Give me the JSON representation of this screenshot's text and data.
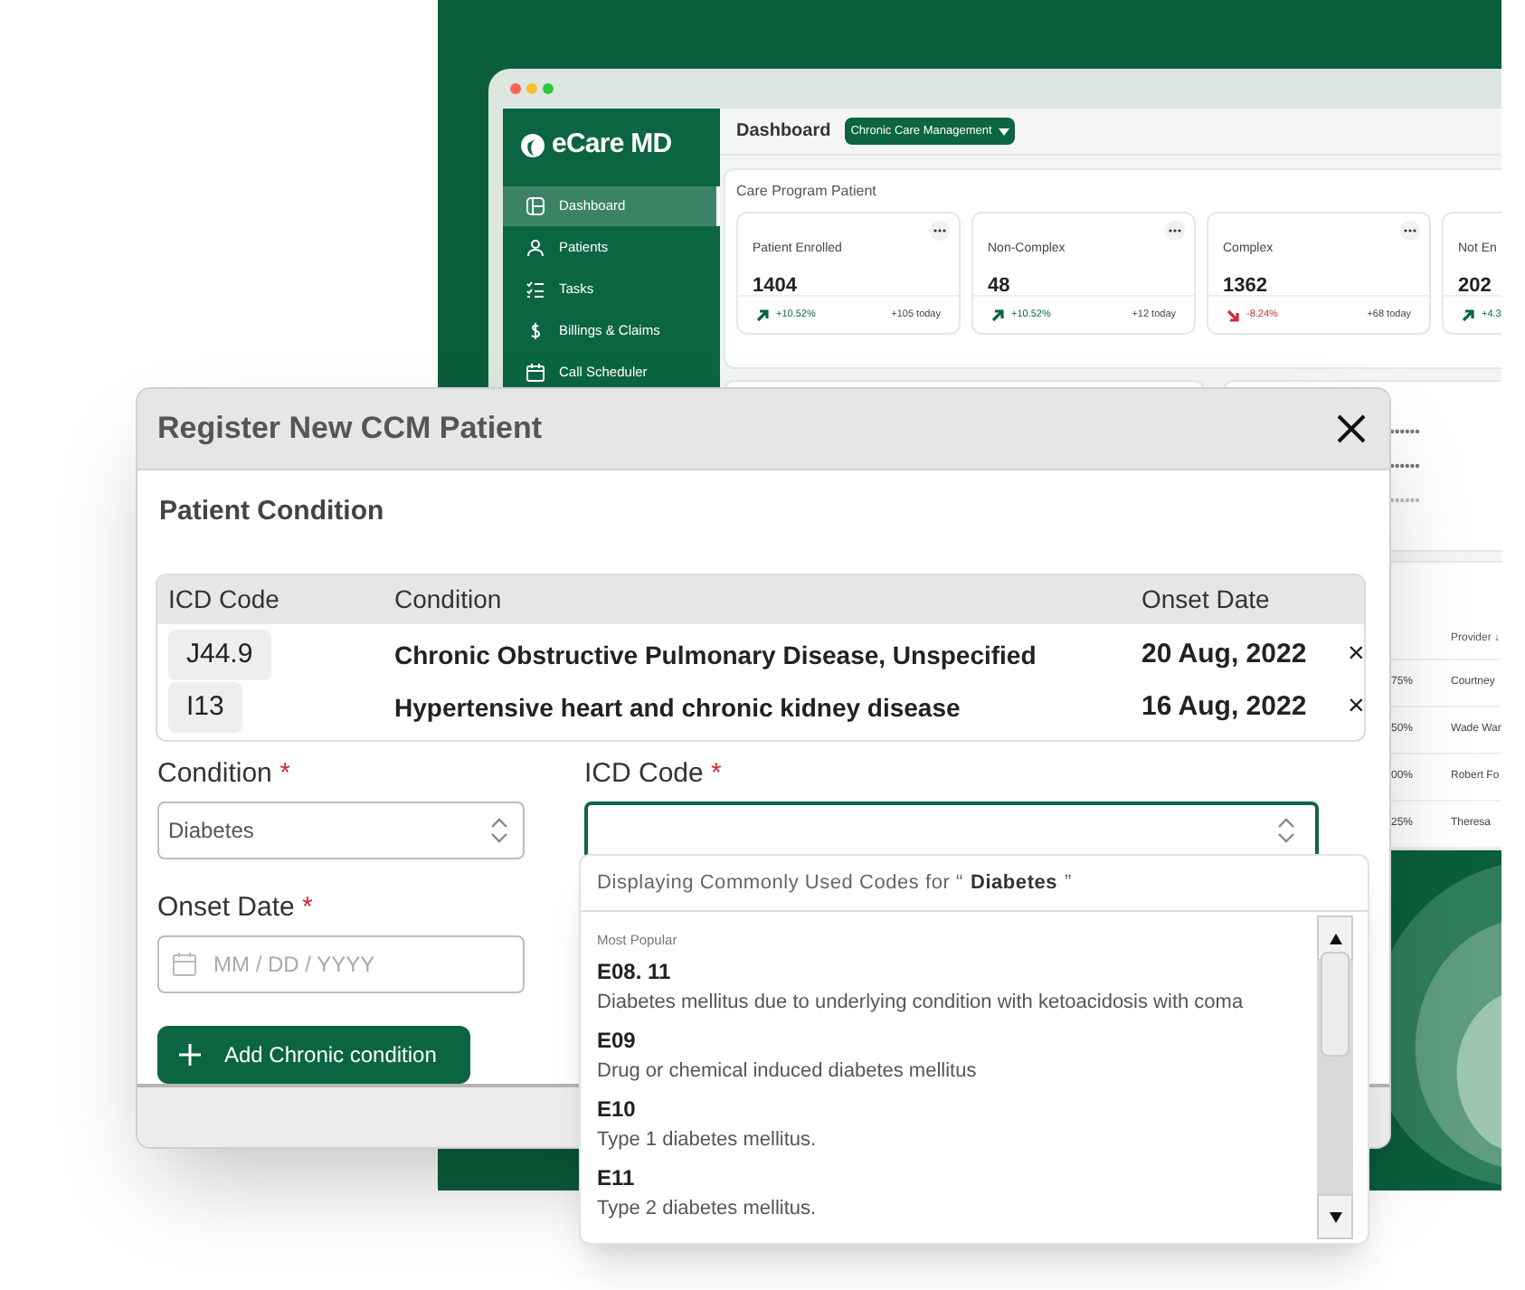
{
  "dashboard": {
    "brand": "eCare MD",
    "sidebar": {
      "items": [
        {
          "label": "Dashboard",
          "selected": true
        },
        {
          "label": "Patients",
          "selected": false
        },
        {
          "label": "Tasks",
          "selected": false
        },
        {
          "label": "Billings & Claims",
          "selected": false
        },
        {
          "label": "Call Scheduler",
          "selected": false
        }
      ]
    },
    "header": {
      "title": "Dashboard",
      "program_select": "Chronic Care Management"
    },
    "care_program": {
      "title": "Care Program Patient",
      "stats": [
        {
          "label": "Patient Enrolled",
          "value": "1404",
          "kind": "up",
          "color": "#0b6542",
          "change": "+10.52%",
          "today": "+105 today",
          "menu": true
        },
        {
          "label": "Non-Complex",
          "value": "48",
          "kind": "up",
          "color": "#0b6542",
          "change": "+10.52%",
          "today": "+12 today",
          "menu": true
        },
        {
          "label": "Complex",
          "value": "1362",
          "kind": "down",
          "color": "#d12c3a",
          "change": "-8.24%",
          "today": "+68 today",
          "menu": true
        },
        {
          "label": "Not En",
          "value": "202",
          "kind": "up",
          "color": "#0b6542",
          "change": "+4.3",
          "menu": false
        }
      ]
    },
    "provider_table": {
      "columns": [
        "Provider ↓"
      ],
      "rows": [
        {
          "percent": "75%",
          "provider": "Courtney"
        },
        {
          "percent": "50%",
          "provider": "Wade War"
        },
        {
          "percent": "00%",
          "provider": "Robert Fo"
        },
        {
          "percent": "25%",
          "provider": "Theresa"
        }
      ]
    }
  },
  "modal": {
    "title": "Register New CCM Patient",
    "section": "Patient Condition",
    "table": {
      "columns": [
        "ICD Code",
        "Condition",
        "Onset Date"
      ],
      "rows": [
        {
          "code": "J44.9",
          "condition": "Chronic Obstructive Pulmonary Disease, Unspecified",
          "onset": "20 Aug, 2022",
          "remove": "×"
        },
        {
          "code": "I13",
          "condition": "Hypertensive heart and chronic kidney disease",
          "onset": "16 Aug, 2022",
          "remove": "×"
        }
      ]
    },
    "condition_field": {
      "label": "Condition",
      "required": true,
      "required_mark": "*",
      "value": "Diabetes",
      "focused": false
    },
    "icd_field": {
      "label": "ICD Code",
      "required": true,
      "required_mark": "*",
      "focused": true
    },
    "onset_field": {
      "label": "Onset Date",
      "required": true,
      "required_mark": "*",
      "placeholder": "MM / DD / YYYY"
    },
    "add_button": "Add Chronic condition"
  },
  "icd_dropdown": {
    "header": "Displaying Commonly Used Codes for “ **Diabetes** ”",
    "group": "Most Popular",
    "items": [
      {
        "code": "E08. 11",
        "description": "Diabetes mellitus due to underlying condition with ketoacidosis with coma"
      },
      {
        "code": "E09",
        "description": "Drug or chemical induced diabetes mellitus"
      },
      {
        "code": "E10",
        "description": "Type 1 diabetes mellitus."
      },
      {
        "code": "E11",
        "description": "Type 2 diabetes mellitus."
      }
    ]
  }
}
